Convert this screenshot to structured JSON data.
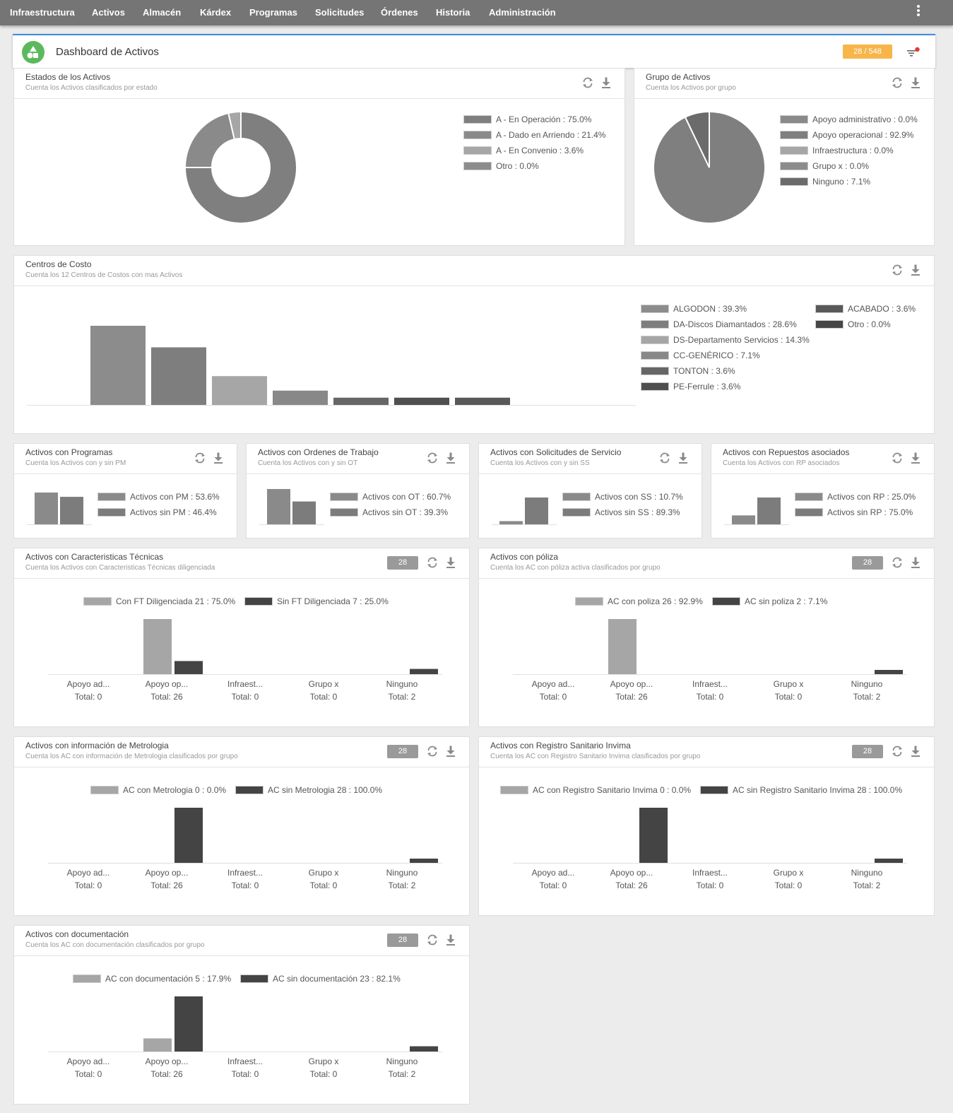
{
  "nav": {
    "items": [
      "Infraestructura",
      "Activos",
      "Almacén",
      "Kárdex",
      "Programas",
      "Solicitudes",
      "Órdenes",
      "Historia",
      "Administración"
    ]
  },
  "header": {
    "title": "Dashboard de Activos",
    "count_badge": "28 / 548"
  },
  "colors": {
    "accent": "#3b8ee0",
    "logo": "#5cb85c",
    "badge": "#f7b54a",
    "alert_dot": "#e53935",
    "light": "#a0a0a0",
    "mid": "#888888",
    "dark": "#444444"
  },
  "icons": {
    "refresh": "refresh-icon",
    "download": "download-icon",
    "filter": "filter-icon",
    "menu": "more-vert-icon",
    "logo": "shapes-icon"
  },
  "panels": {
    "estados": {
      "title": "Estados de los Activos",
      "subtitle": "Cuenta los Activos clasificados por estado"
    },
    "grupo": {
      "title": "Grupo de Activos",
      "subtitle": "Cuenta los Activos por grupo"
    },
    "centros": {
      "title": "Centros de Costo",
      "subtitle": "Cuenta los 12 Centros de Costos con mas Activos"
    },
    "programas": {
      "title": "Activos con Programas",
      "subtitle": "Cuenta los Activos con y sin PM"
    },
    "ordenes": {
      "title": "Activos con Ordenes de Trabajo",
      "subtitle": "Cuenta los Activos con y sin OT"
    },
    "solicitudes": {
      "title": "Activos con Solicitudes de Servicio",
      "subtitle": "Cuenta los Activos con y sin SS"
    },
    "repuestos": {
      "title": "Activos con Repuestos asociados",
      "subtitle": "Cuenta los Activos con RP asociados"
    },
    "tecnicas": {
      "title": "Activos con Caracteristicas Técnicas",
      "subtitle": "Cuenta los Activos con Caracteristicas Técnicas diligenciada",
      "badge": "28"
    },
    "poliza": {
      "title": "Activos con póliza",
      "subtitle": "Cuenta los AC con póliza activa clasificados por grupo",
      "badge": "28"
    },
    "metrologia": {
      "title": "Activos con información de Metrologia",
      "subtitle": "Cuenta los AC con información de Metrologia clasificados por grupo",
      "badge": "28"
    },
    "invima": {
      "title": "Activos con Registro Sanitario Invima",
      "subtitle": "Cuenta los AC con Registro Sanitario Invima clasificados por grupo",
      "badge": "28"
    },
    "documentacion": {
      "title": "Activos con documentación",
      "subtitle": "Cuenta los AC con documentación clasificados por grupo",
      "badge": "28"
    }
  },
  "chart_data": [
    {
      "id": "estados",
      "type": "pie",
      "donut": true,
      "labels": [
        "A - En Operación : 75.0%",
        "A - Dado en Arriendo : 21.4%",
        "A - En Convenio : 3.6%",
        "Otro : 0.0%"
      ],
      "values": [
        75.0,
        21.4,
        3.6,
        0.0
      ],
      "colors": [
        "#7f7f7f",
        "#8a8a8a",
        "#a6a6a6",
        "#8c8c8c"
      ]
    },
    {
      "id": "grupo",
      "type": "pie",
      "donut": false,
      "labels": [
        "Apoyo administrativo : 0.0%",
        "Apoyo operacional : 92.9%",
        "Infraestructura : 0.0%",
        "Grupo x : 0.0%",
        "Ninguno : 7.1%"
      ],
      "values": [
        0.0,
        92.9,
        0.0,
        0.0,
        7.1
      ],
      "colors": [
        "#8a8a8a",
        "#7f7f7f",
        "#a6a6a6",
        "#8c8c8c",
        "#6b6b6b"
      ]
    },
    {
      "id": "centros",
      "type": "bar",
      "labels": [
        "ALGODON : 39.3%",
        "DA-Discos Diamantados : 28.6%",
        "DS-Departamento Servicios : 14.3%",
        "CC-GENÉRICO : 7.1%",
        "TONTON : 3.6%",
        "PE-Ferrule : 3.6%",
        "ACABADO : 3.6%",
        "Otro : 0.0%"
      ],
      "values": [
        39.3,
        28.6,
        14.3,
        7.1,
        3.6,
        3.6,
        3.6,
        0.0
      ],
      "colors": [
        "#8c8c8c",
        "#7e7e7e",
        "#a6a6a6",
        "#888888",
        "#666666",
        "#4f4f4f",
        "#595959",
        "#474747"
      ]
    },
    {
      "id": "programas",
      "type": "bar",
      "labels": [
        "Activos con PM : 53.6%",
        "Activos sin PM : 46.4%"
      ],
      "values": [
        53.6,
        46.4
      ],
      "colors": [
        "#8a8a8a",
        "#7c7c7c"
      ]
    },
    {
      "id": "ordenes",
      "type": "bar",
      "labels": [
        "Activos con OT : 60.7%",
        "Activos sin OT : 39.3%"
      ],
      "values": [
        60.7,
        39.3
      ],
      "colors": [
        "#8a8a8a",
        "#7c7c7c"
      ]
    },
    {
      "id": "solicitudes",
      "type": "bar",
      "labels": [
        "Activos con SS : 10.7%",
        "Activos sin SS : 89.3%"
      ],
      "values": [
        10.7,
        89.3
      ],
      "colors": [
        "#8a8a8a",
        "#7c7c7c"
      ]
    },
    {
      "id": "repuestos",
      "type": "bar",
      "labels": [
        "Activos con RP : 25.0%",
        "Activos sin RP : 75.0%"
      ],
      "values": [
        25.0,
        75.0
      ],
      "colors": [
        "#8a8a8a",
        "#7c7c7c"
      ]
    },
    {
      "id": "tecnicas",
      "type": "bar",
      "categories": [
        "Apoyo ad...",
        "Apoyo op...",
        "Infraest...",
        "Grupo x",
        "Ninguno"
      ],
      "totals": [
        "Total: 0",
        "Total: 26",
        "Total: 0",
        "Total: 0",
        "Total: 2"
      ],
      "series": [
        {
          "name": "Con FT Diligenciada 21  : 75.0%",
          "values": [
            0,
            21,
            0,
            0,
            0
          ],
          "color": "#a6a6a6"
        },
        {
          "name": "Sin FT Diligenciada 7  : 25.0%",
          "values": [
            0,
            5,
            0,
            0,
            2
          ],
          "color": "#444444"
        }
      ]
    },
    {
      "id": "poliza",
      "type": "bar",
      "categories": [
        "Apoyo ad...",
        "Apoyo op...",
        "Infraest...",
        "Grupo x",
        "Ninguno"
      ],
      "totals": [
        "Total: 0",
        "Total: 26",
        "Total: 0",
        "Total: 0",
        "Total: 2"
      ],
      "series": [
        {
          "name": "AC con poliza 26  : 92.9%",
          "values": [
            0,
            26,
            0,
            0,
            0
          ],
          "color": "#a6a6a6"
        },
        {
          "name": "AC sin poliza 2  : 7.1%",
          "values": [
            0,
            0,
            0,
            0,
            2
          ],
          "color": "#444444"
        }
      ]
    },
    {
      "id": "metrologia",
      "type": "bar",
      "categories": [
        "Apoyo ad...",
        "Apoyo op...",
        "Infraest...",
        "Grupo x",
        "Ninguno"
      ],
      "totals": [
        "Total: 0",
        "Total: 26",
        "Total: 0",
        "Total: 0",
        "Total: 2"
      ],
      "series": [
        {
          "name": "AC con Metrologia 0  : 0.0%",
          "values": [
            0,
            0,
            0,
            0,
            0
          ],
          "color": "#a6a6a6"
        },
        {
          "name": "AC sin Metrologia 28  : 100.0%",
          "values": [
            0,
            26,
            0,
            0,
            2
          ],
          "color": "#444444"
        }
      ]
    },
    {
      "id": "invima",
      "type": "bar",
      "categories": [
        "Apoyo ad...",
        "Apoyo op...",
        "Infraest...",
        "Grupo x",
        "Ninguno"
      ],
      "totals": [
        "Total: 0",
        "Total: 26",
        "Total: 0",
        "Total: 0",
        "Total: 2"
      ],
      "series": [
        {
          "name": "AC con Registro Sanitario Invima 0  : 0.0%",
          "values": [
            0,
            0,
            0,
            0,
            0
          ],
          "color": "#a6a6a6"
        },
        {
          "name": "AC sin Registro Sanitario Invima 28  : 100.0%",
          "values": [
            0,
            26,
            0,
            0,
            2
          ],
          "color": "#444444"
        }
      ]
    },
    {
      "id": "documentacion",
      "type": "bar",
      "categories": [
        "Apoyo ad...",
        "Apoyo op...",
        "Infraest...",
        "Grupo x",
        "Ninguno"
      ],
      "totals": [
        "Total: 0",
        "Total: 26",
        "Total: 0",
        "Total: 0",
        "Total: 2"
      ],
      "series": [
        {
          "name": "AC con documentación 5  : 17.9%",
          "values": [
            0,
            5,
            0,
            0,
            0
          ],
          "color": "#a6a6a6"
        },
        {
          "name": "AC sin documentación 23  : 82.1%",
          "values": [
            0,
            21,
            0,
            0,
            2
          ],
          "color": "#444444"
        }
      ]
    }
  ]
}
